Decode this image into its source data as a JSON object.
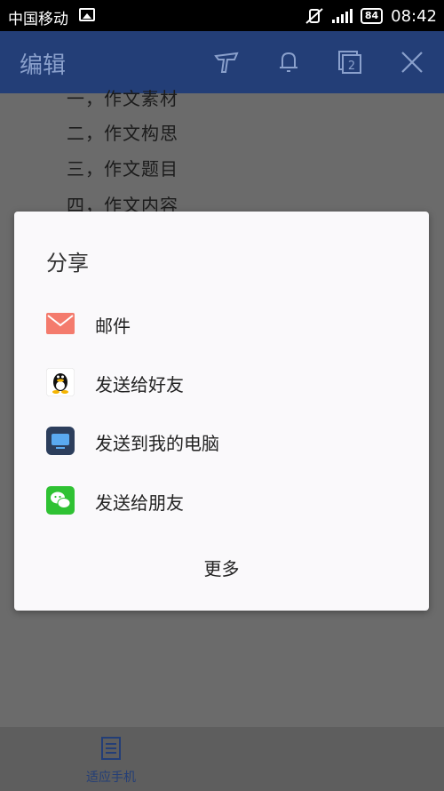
{
  "status_bar": {
    "carrier": "中国移动",
    "battery": "84",
    "time": "08:42"
  },
  "app_bar": {
    "title": "编辑",
    "icons": [
      "brush-icon",
      "bell-icon",
      "pages-icon",
      "close-icon"
    ],
    "pages_count": "2"
  },
  "document": {
    "lines": [
      "一，作文素材",
      "二，作文构思",
      "三，作文题目",
      "四，作文内容"
    ]
  },
  "dialog": {
    "title": "分享",
    "items": [
      {
        "label": "邮件",
        "icon": "mail-icon"
      },
      {
        "label": "发送给好友",
        "icon": "qq-icon"
      },
      {
        "label": "发送到我的电脑",
        "icon": "computer-icon"
      },
      {
        "label": "发送给朋友",
        "icon": "wechat-icon"
      }
    ],
    "more": "更多"
  },
  "bottom_bar": {
    "label": "适应手机",
    "icon": "document-icon"
  },
  "colors": {
    "header": "#233e77",
    "mail": "#f47b6d",
    "wechat": "#2fc233",
    "computer": "#2c63b8"
  }
}
